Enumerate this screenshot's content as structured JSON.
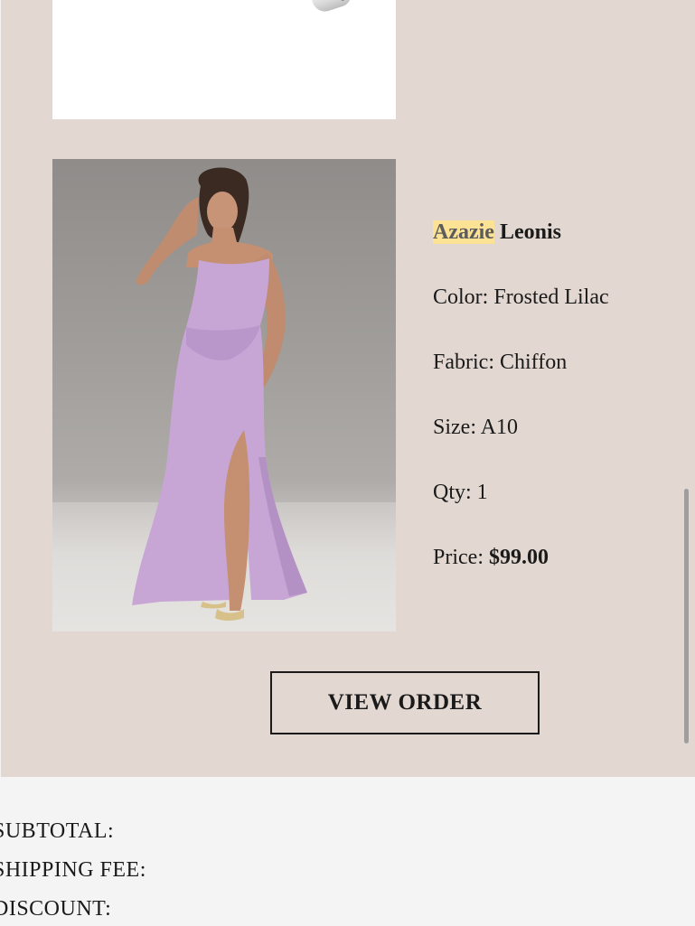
{
  "order_item": {
    "brand": "Azazie",
    "name": "Leonis",
    "color_label": "Color:",
    "color_value": "Frosted Lilac",
    "fabric_label": "Fabric:",
    "fabric_value": "Chiffon",
    "size_label": "Size:",
    "size_value": "A10",
    "qty_label": "Qty:",
    "qty_value": "1",
    "price_label": "Price:",
    "price_value": "$99.00"
  },
  "actions": {
    "view_order_label": "VIEW ORDER"
  },
  "summary": {
    "subtotal_label": "SUBTOTAL:",
    "shipping_label": "SHIPPING FEE:",
    "discount_label": "DISCOUNT:"
  },
  "colors": {
    "panel_background": "#e3d8d1",
    "summary_background": "#f4f4f4",
    "brand_highlight": "#fbe295",
    "dress_color": "#c7a6d6"
  },
  "icons": {
    "previous_item_image": "shoe-product-image",
    "current_item_image": "dress-product-image"
  }
}
